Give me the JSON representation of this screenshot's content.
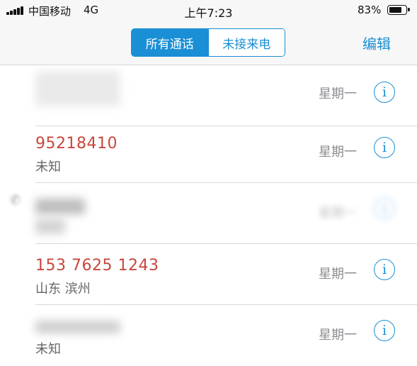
{
  "status": {
    "carrier": "中国移动",
    "network": "4G",
    "time": "上午7:23",
    "battery_pct": "83%",
    "battery_level": 0.83,
    "signal_bars": 5
  },
  "nav": {
    "tabs": [
      {
        "label": "所有通话",
        "active": true
      },
      {
        "label": "未接来电",
        "active": false
      }
    ],
    "edit_label": "编辑"
  },
  "calls": [
    {
      "number": "",
      "location": "",
      "day": "星期一",
      "blurred": true
    },
    {
      "number": "95218410",
      "location": "未知",
      "day": "星期一",
      "blurred": false
    },
    {
      "number": "",
      "location": "",
      "day": "星期一",
      "blurred": true
    },
    {
      "number": "153 7625 1243",
      "location": "山东 滨州",
      "day": "星期一",
      "blurred": false
    },
    {
      "number": "",
      "location": "未知",
      "day": "星期一",
      "blurred": true
    }
  ],
  "info_glyph": "i",
  "colors": {
    "accent": "#1a8fd6",
    "missed_call": "#c8473d",
    "secondary_text": "#8e8e93"
  }
}
